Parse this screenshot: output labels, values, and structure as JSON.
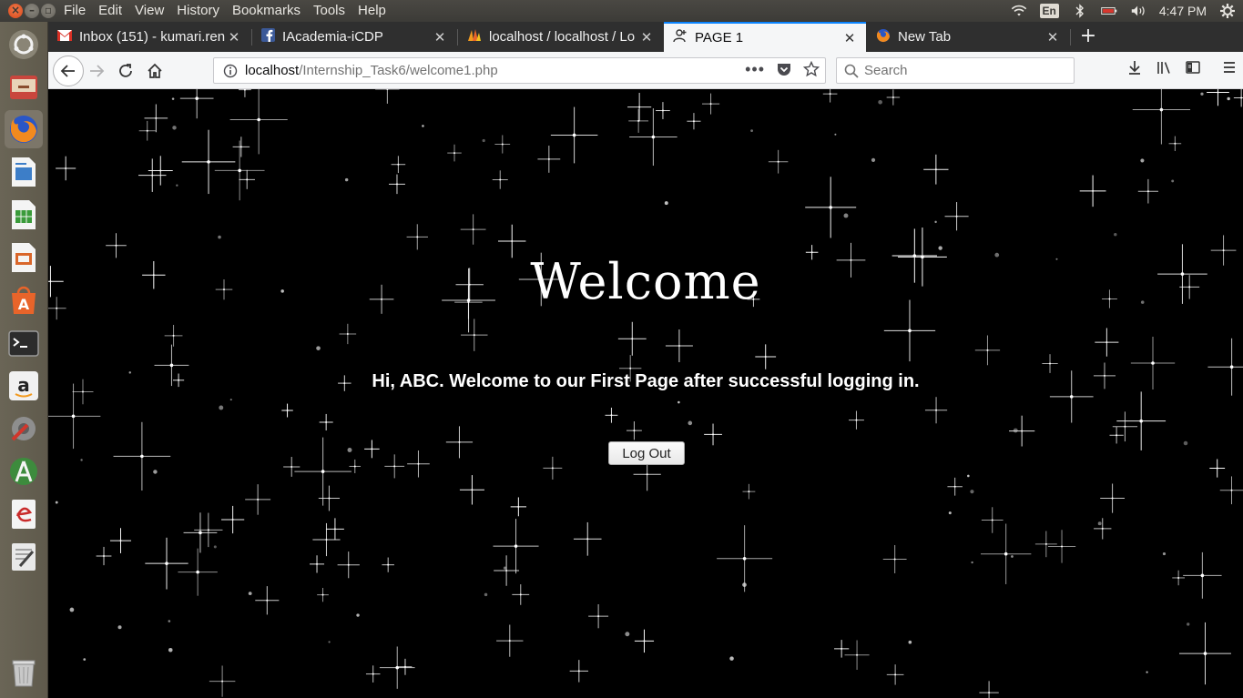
{
  "menubar": {
    "items": [
      "File",
      "Edit",
      "View",
      "History",
      "Bookmarks",
      "Tools",
      "Help"
    ]
  },
  "indicators": {
    "language": "En",
    "clock": "4:47 PM"
  },
  "tabs": [
    {
      "title": "Inbox (151) - kumari.ren",
      "icon": "gmail-icon",
      "active": false
    },
    {
      "title": "IAcademia-iCDP",
      "icon": "facebook-icon",
      "active": false
    },
    {
      "title": "localhost / localhost / Lo",
      "icon": "phpmyadmin-icon",
      "active": false
    },
    {
      "title": "PAGE 1",
      "icon": "user-add-icon",
      "active": true
    },
    {
      "title": "New Tab",
      "icon": "firefox-icon",
      "active": false
    }
  ],
  "navbar": {
    "url_host": "localhost",
    "url_path": "/Internship_Task6/welcome1.php",
    "search_placeholder": "Search"
  },
  "page": {
    "title": "Welcome",
    "greeting_prefix": "Hi, ",
    "username": "ABC",
    "greeting_suffix": ". Welcome to our First Page after successful logging in.",
    "logout_label": "Log Out"
  },
  "colors": {
    "accent": "#0a84ff",
    "page_background": "#000000",
    "text": "#ffffff"
  }
}
